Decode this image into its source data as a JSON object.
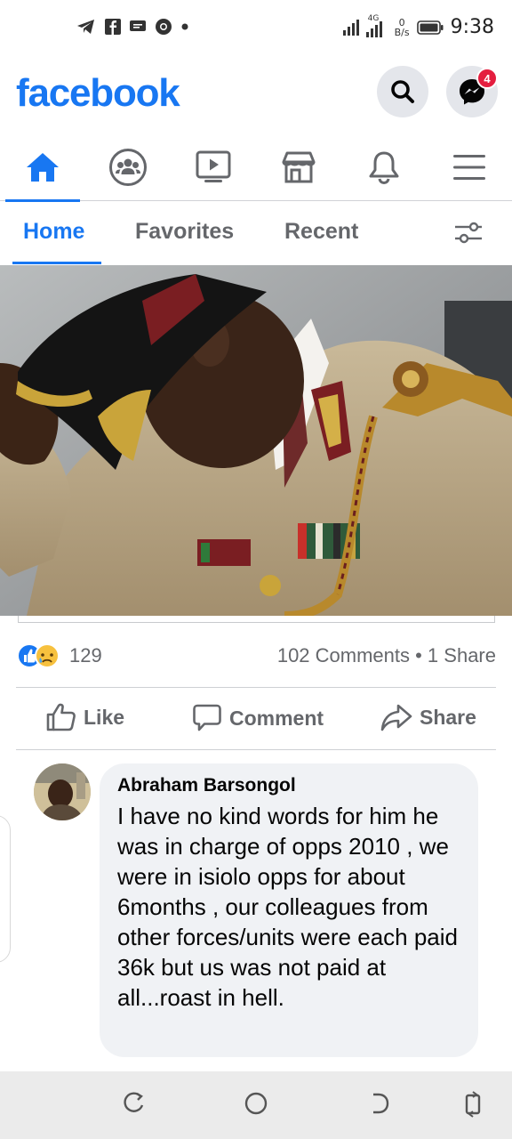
{
  "status_bar": {
    "net_speed_value": "0",
    "net_speed_unit": "B/s",
    "network_type": "4G",
    "time": "9:38"
  },
  "header": {
    "logo_text": "facebook",
    "messenger_badge": "4"
  },
  "nav": {
    "items": [
      "home-icon",
      "groups-icon",
      "watch-icon",
      "marketplace-icon",
      "notifications-icon",
      "menu-icon"
    ],
    "active": "home-icon"
  },
  "feed_filters": {
    "tabs": [
      {
        "label": "Home"
      },
      {
        "label": "Favorites"
      },
      {
        "label": "Recent"
      }
    ],
    "active": "Home"
  },
  "post": {
    "reaction_count": "129",
    "comments_shares": "102 Comments • 1 Share",
    "actions": {
      "like": "Like",
      "comment": "Comment",
      "share": "Share"
    }
  },
  "comment": {
    "author": "Abraham Barsongol",
    "text": "I have no kind words for him he was in charge of opps 2010 , we were in isiolo opps for about 6months , our colleagues from other forces/units were each paid 36k but us was not paid at all...roast in hell."
  },
  "colors": {
    "brand": "#1877f2",
    "muted": "#65676b",
    "badge": "#e41e3f",
    "bubble": "#f0f2f5"
  }
}
